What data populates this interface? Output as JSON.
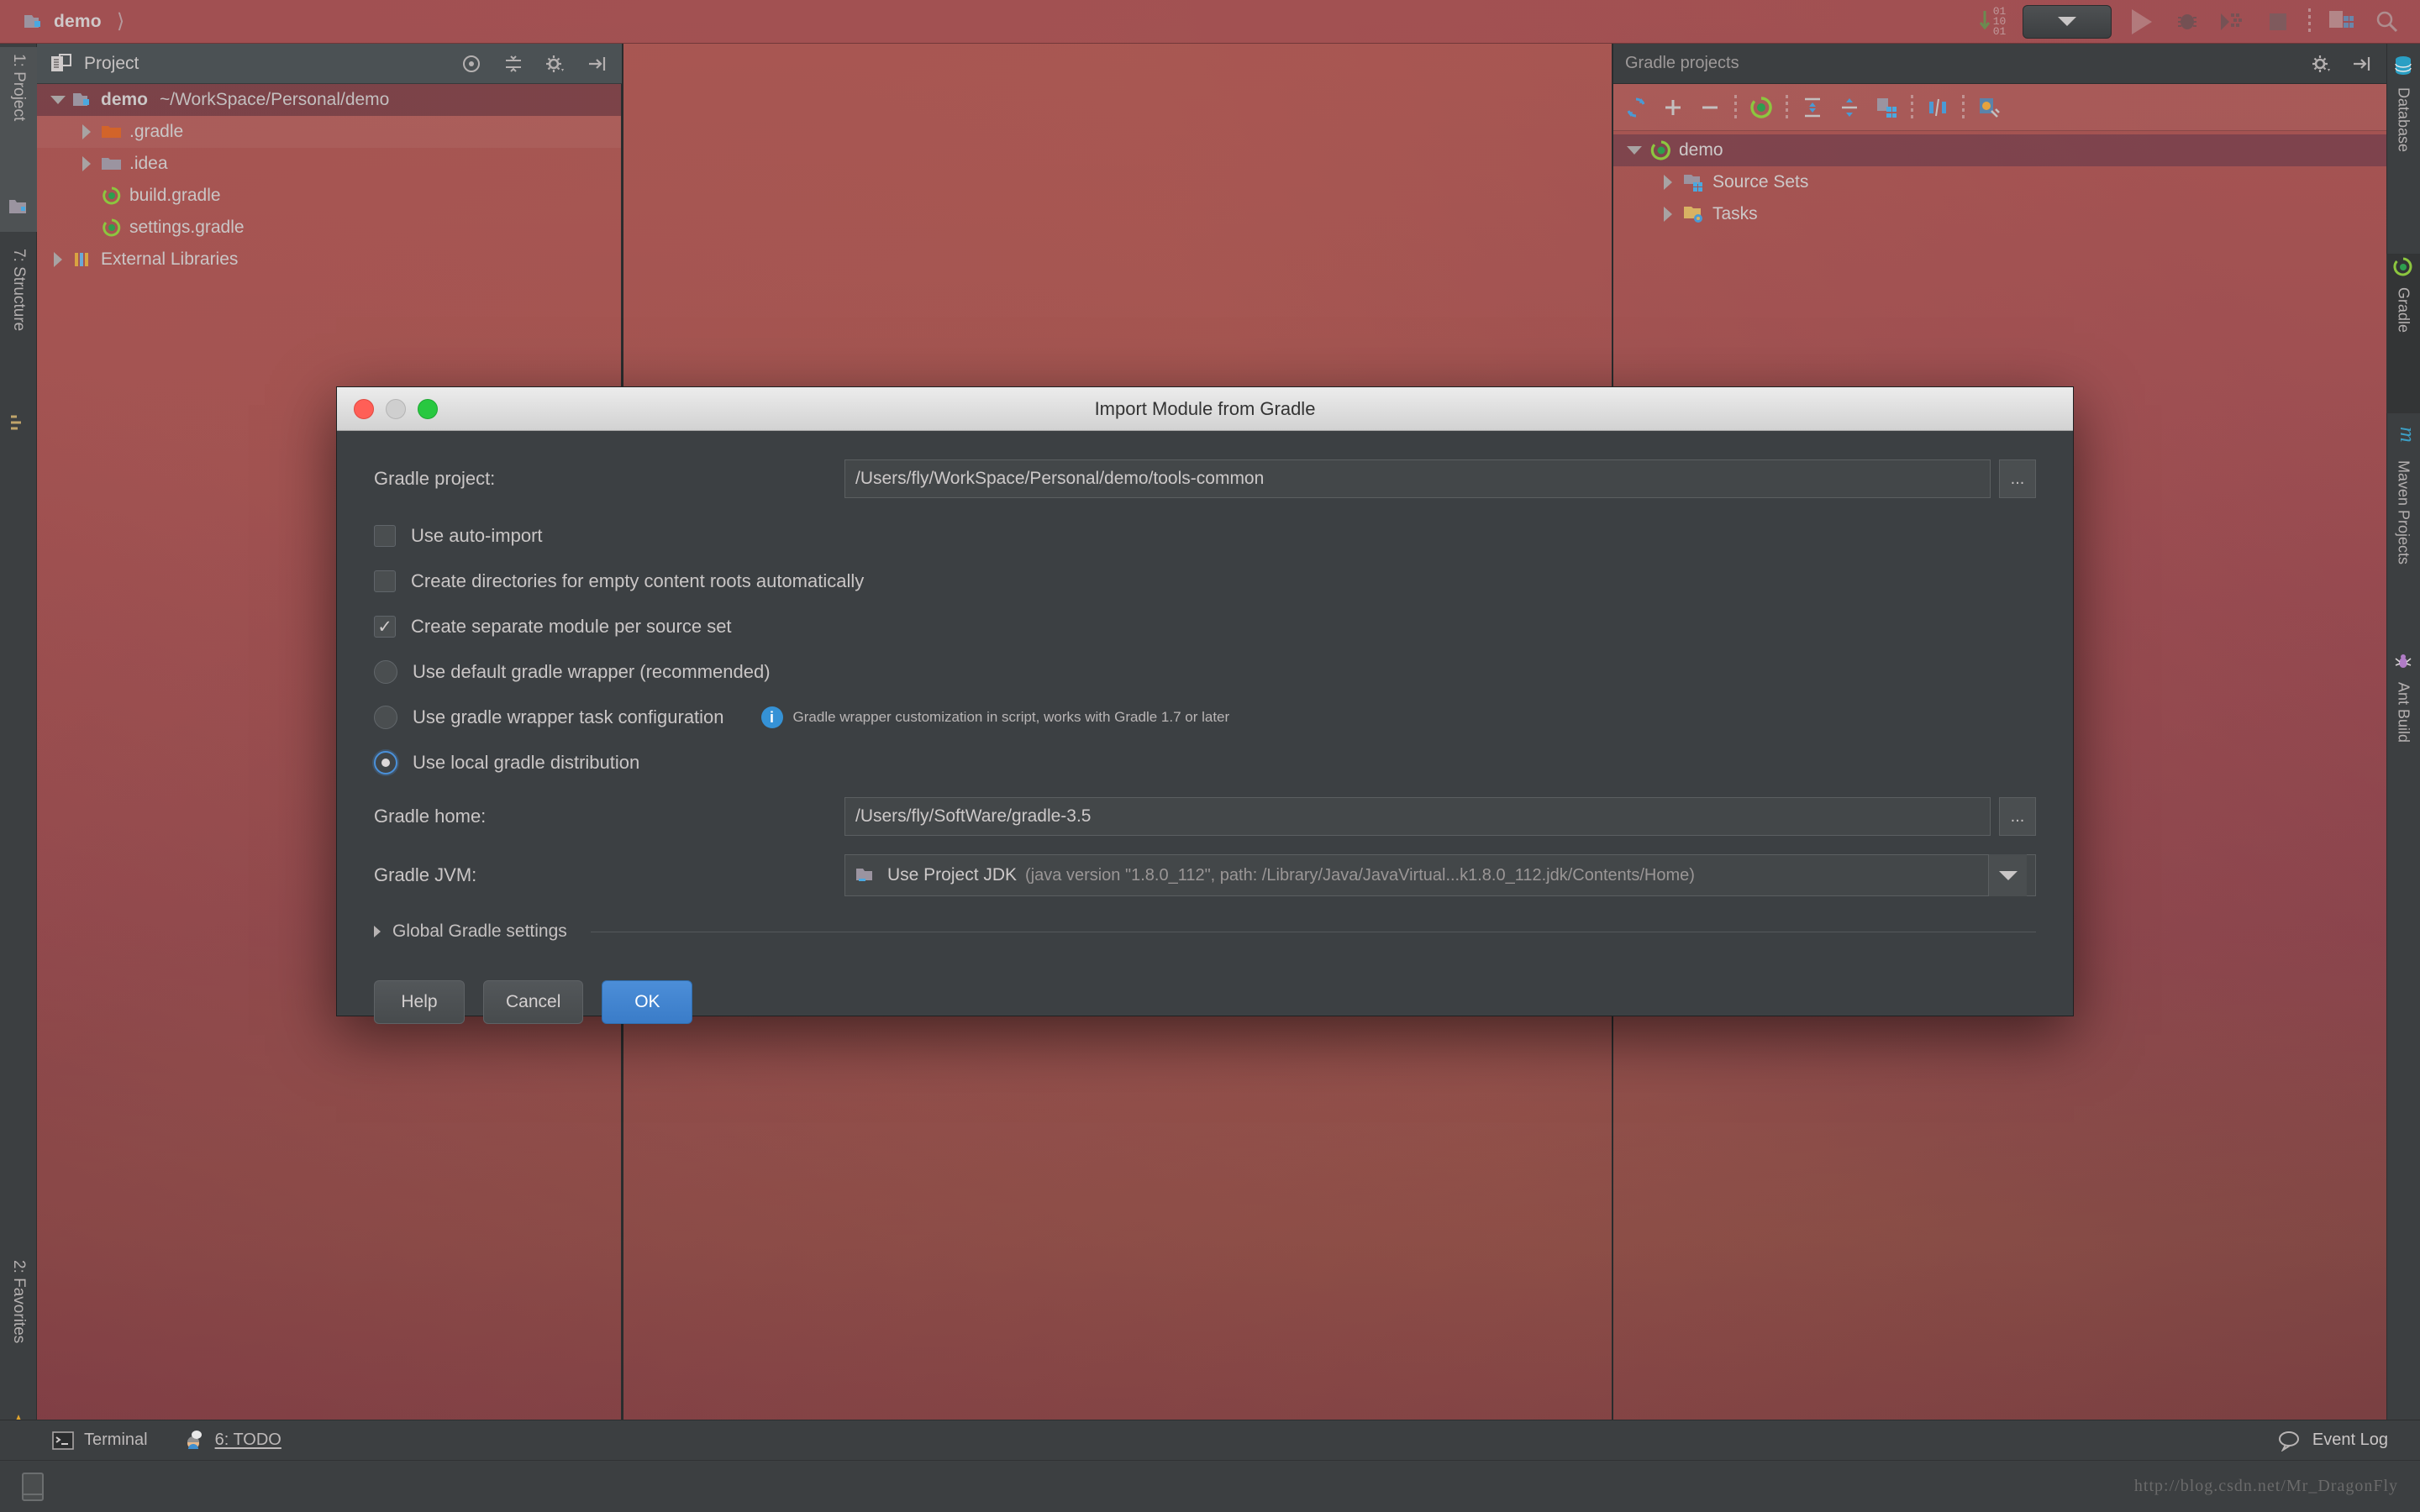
{
  "topbar": {
    "breadcrumb": "demo",
    "icons": [
      {
        "name": "binary-toggle-icon"
      },
      {
        "name": "run-configuration-select"
      },
      {
        "name": "run-icon"
      },
      {
        "name": "debug-icon"
      },
      {
        "name": "coverage-icon"
      },
      {
        "name": "stop-icon"
      },
      {
        "name": "project-structure-icon"
      },
      {
        "name": "search-everywhere-icon"
      }
    ]
  },
  "left_strip": {
    "tabs": [
      {
        "label": "1: Project",
        "icon": "project-icon"
      },
      {
        "label": "7: Structure",
        "icon": "structure-icon"
      },
      {
        "label": "2: Favorites",
        "icon": "star-icon"
      }
    ]
  },
  "project_pane": {
    "title": "Project",
    "header_icons": [
      "target-icon",
      "collapse-all-icon",
      "gear-icon",
      "hide-icon"
    ],
    "tree": [
      {
        "label": "demo",
        "path": "~/WorkSpace/Personal/demo",
        "icon": "module-folder-icon",
        "expanded": true,
        "depth": 0,
        "selected": true
      },
      {
        "label": ".gradle",
        "path": "",
        "icon": "orange-folder-icon",
        "expanded": false,
        "depth": 1,
        "selected": false
      },
      {
        "label": ".idea",
        "path": "",
        "icon": "grey-folder-icon",
        "expanded": false,
        "depth": 1,
        "selected": false
      },
      {
        "label": "build.gradle",
        "path": "",
        "icon": "gradle-file-icon",
        "expanded": null,
        "depth": 1,
        "selected": false
      },
      {
        "label": "settings.gradle",
        "path": "",
        "icon": "gradle-file-icon",
        "expanded": null,
        "depth": 1,
        "selected": false
      },
      {
        "label": "External Libraries",
        "path": "",
        "icon": "libraries-icon",
        "expanded": false,
        "depth": 0,
        "selected": false
      }
    ]
  },
  "gradle_pane": {
    "title": "Gradle projects",
    "header_icons": [
      "gear-icon",
      "hide-icon"
    ],
    "toolbar_icons": [
      "refresh-all-icon",
      "attach-icon",
      "detach-icon",
      "execute-task-icon",
      "expand-all-icon",
      "collapse-all-icon",
      "toggle-offline-icon",
      "skip-tests-icon",
      "gradle-settings-icon"
    ],
    "tree": [
      {
        "label": "demo",
        "icon": "gradle-project-icon",
        "expanded": true,
        "depth": 0,
        "selected": true
      },
      {
        "label": "Source Sets",
        "icon": "source-sets-icon",
        "expanded": false,
        "depth": 1,
        "selected": false
      },
      {
        "label": "Tasks",
        "icon": "tasks-icon",
        "expanded": false,
        "depth": 1,
        "selected": false
      }
    ]
  },
  "right_strip": {
    "tabs": [
      {
        "label": "Database",
        "icon": "database-icon",
        "active": false
      },
      {
        "label": "Gradle",
        "icon": "gradle-icon",
        "active": true
      },
      {
        "label": "Maven Projects",
        "icon": "maven-icon",
        "active": false
      },
      {
        "label": "Ant Build",
        "icon": "ant-icon",
        "active": false
      }
    ]
  },
  "bottom_bar": {
    "items": [
      {
        "label": "Terminal",
        "icon": "terminal-icon"
      },
      {
        "label": "6: TODO",
        "icon": "todo-icon"
      }
    ],
    "event_log": {
      "label": "Event Log",
      "icon": "balloon-icon"
    }
  },
  "status_bar": {
    "watermark": "http://blog.csdn.net/Mr_DragonFly"
  },
  "dialog": {
    "title": "Import Module from Gradle",
    "gradle_project": {
      "label": "Gradle project:",
      "value": "/Users/fly/WorkSpace/Personal/demo/tools-common",
      "browse_label": "..."
    },
    "checkboxes": [
      {
        "label": "Use auto-import",
        "checked": false
      },
      {
        "label": "Create directories for empty content roots automatically",
        "checked": false
      },
      {
        "label": "Create separate module per source set",
        "checked": true
      }
    ],
    "radios": [
      {
        "label": "Use default gradle wrapper (recommended)",
        "selected": false,
        "hint": ""
      },
      {
        "label": "Use gradle wrapper task configuration",
        "selected": false,
        "hint": "Gradle wrapper customization in script, works with Gradle 1.7 or later"
      },
      {
        "label": "Use local gradle distribution",
        "selected": true,
        "hint": ""
      }
    ],
    "gradle_home": {
      "label": "Gradle home:",
      "value": "/Users/fly/SoftWare/gradle-3.5",
      "browse_label": "..."
    },
    "gradle_jvm": {
      "label": "Gradle JVM:",
      "value": "Use Project JDK",
      "detail": "(java version \"1.8.0_112\", path: /Library/Java/JavaVirtual...k1.8.0_112.jdk/Contents/Home)",
      "icon": "jdk-folder-icon"
    },
    "global_settings_label": "Global Gradle settings",
    "buttons": {
      "help": "Help",
      "cancel": "Cancel",
      "ok": "OK"
    }
  },
  "colors": {
    "accent_blue": "#4a90d9",
    "panel_bg": "#3c3f41",
    "dialog_bg": "#3c4043",
    "wallpaper": "#8e4252"
  }
}
